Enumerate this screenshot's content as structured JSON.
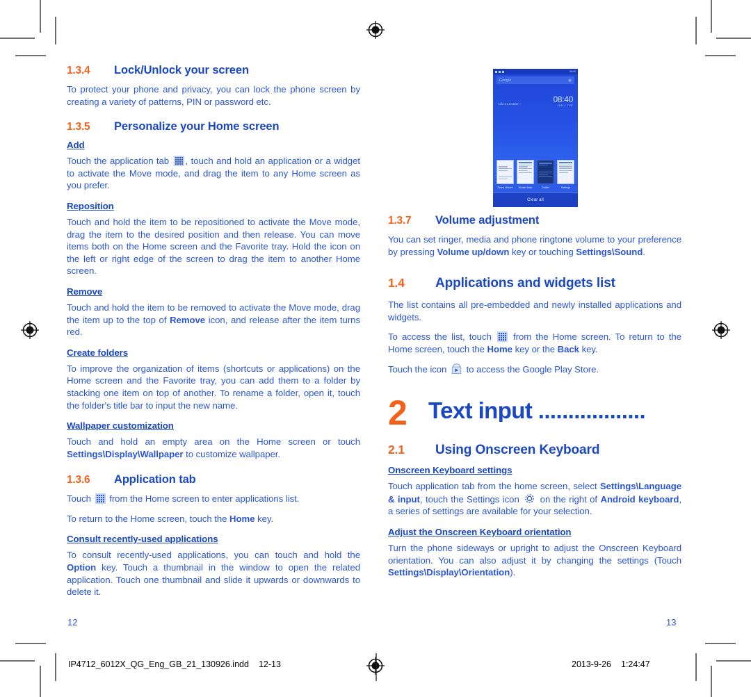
{
  "colors": {
    "orange": "#f4611a",
    "blue_heading": "#1a47c2",
    "blue_body": "#2b57d6",
    "crop_mark": "#6e6e6e"
  },
  "left_column": {
    "section_134": {
      "number": "1.3.4",
      "title": "Lock/Unlock your screen",
      "body": "To protect your phone and privacy, you can lock the phone screen by creating a variety of patterns, PIN or password etc."
    },
    "section_135": {
      "number": "1.3.5",
      "title": "Personalize your Home screen",
      "sub_add": {
        "heading": "Add",
        "body_1": "Touch the application tab",
        "body_2": ", touch and hold an application or a widget to activate the Move mode, and drag the item to any Home screen as you prefer."
      },
      "sub_reposition": {
        "heading": "Reposition",
        "body": "Touch and hold the item to be repositioned to activate the Move mode, drag the item to the desired position and then release. You can move items both on the Home screen and the Favorite tray. Hold the icon on the left or right edge of the screen to drag the item to another Home screen."
      },
      "sub_remove": {
        "heading": "Remove",
        "body_1": "Touch and hold the item to be removed to activate the Move mode, drag the item up to the top of ",
        "body_bold": "Remove",
        "body_2": " icon, and release after the item turns red."
      },
      "sub_create_folders": {
        "heading": "Create folders",
        "body": "To improve the organization of items (shortcuts or applications) on the Home screen and the Favorite tray, you can add them to a folder by stacking one item on top of another. To rename a folder, open it, touch the folder's title bar to input the new name."
      },
      "sub_wallpaper": {
        "heading": "Wallpaper customization",
        "body_1": "Touch and hold an empty area on the Home screen or touch ",
        "body_bold": "Settings\\Display\\Wallpaper",
        "body_2": " to customize wallpaper."
      }
    },
    "section_136": {
      "number": "1.3.6",
      "title": "Application tab",
      "body_1_pre": "Touch",
      "body_1_post": "from the Home screen to enter applications list.",
      "body_2_pre": "To return to the Home screen, touch the ",
      "body_2_bold": "Home",
      "body_2_post": " key.",
      "sub_consult": {
        "heading": "Consult recently-used applications",
        "body_1": "To consult recently-used applications, you can touch and hold the ",
        "body_bold": "Option",
        "body_2": " key. Touch a thumbnail in the window to open the related application. Touch one thumbnail and slide it upwards or downwards to delete it."
      }
    }
  },
  "right_column": {
    "phone_screenshot": {
      "status_time": "08:40",
      "search_placeholder": "Google",
      "location_widget": "Add a Location",
      "clock_time": "08:40",
      "clock_date": "JAN 1 TUE",
      "thumbnails": [
        {
          "label": "Setup Wizard"
        },
        {
          "label": "Alcatel Help"
        },
        {
          "label": "Twitter"
        },
        {
          "label": "Settings"
        }
      ],
      "clear_all_label": "Clear all"
    },
    "section_137": {
      "number": "1.3.7",
      "title": "Volume adjustment",
      "body_1": "You can set ringer, media and phone ringtone volume to your preference by pressing ",
      "body_bold_1": "Volume up/down",
      "body_2": " key or touching ",
      "body_bold_2": "Settings\\Sound",
      "body_3": "."
    },
    "section_14": {
      "number": "1.4",
      "title": "Applications and widgets list",
      "body_1": "The list contains all pre-embedded and newly installed applications and widgets.",
      "body_2_pre": "To access the list, touch",
      "body_2_mid": "from the Home screen. To return to the Home screen, touch the ",
      "body_2_bold_1": "Home",
      "body_2_mid2": " key or the ",
      "body_2_bold_2": "Back",
      "body_2_post": " key.",
      "body_3_pre": "Touch the icon",
      "body_3_post": "to access the Google Play Store."
    },
    "chapter_2": {
      "number": "2",
      "title": "Text input",
      "leader": ".................."
    },
    "section_21": {
      "number": "2.1",
      "title": "Using Onscreen Keyboard",
      "sub_settings": {
        "heading": "Onscreen Keyboard settings",
        "body_1": "Touch application tab from the home screen, select ",
        "body_bold_1": "Settings\\Language & input",
        "body_2": ", touch the Settings icon",
        "body_3": "on the right of ",
        "body_bold_2": "Android keyboard",
        "body_4": ", a series of settings are available for your selection."
      },
      "sub_orientation": {
        "heading": "Adjust the Onscreen Keyboard orientation",
        "body_1": "Turn the phone sideways or upright to adjust the Onscreen Keyboard orientation. You can also adjust it by changing the settings (Touch ",
        "body_bold": "Settings\\Display\\Orientation",
        "body_2": ")."
      }
    }
  },
  "page_numbers": {
    "left": "12",
    "right": "13"
  },
  "footer": {
    "filename": "IP4712_6012X_QG_Eng_GB_21_130926.indd",
    "spread": "12-13",
    "date": "2013-9-26",
    "time": "1:24:47"
  },
  "icons": {
    "app_tab": "app-grid-icon",
    "play_store": "google-play-bag-icon",
    "settings_gear": "gear-icon",
    "registration": "registration-target-icon"
  }
}
